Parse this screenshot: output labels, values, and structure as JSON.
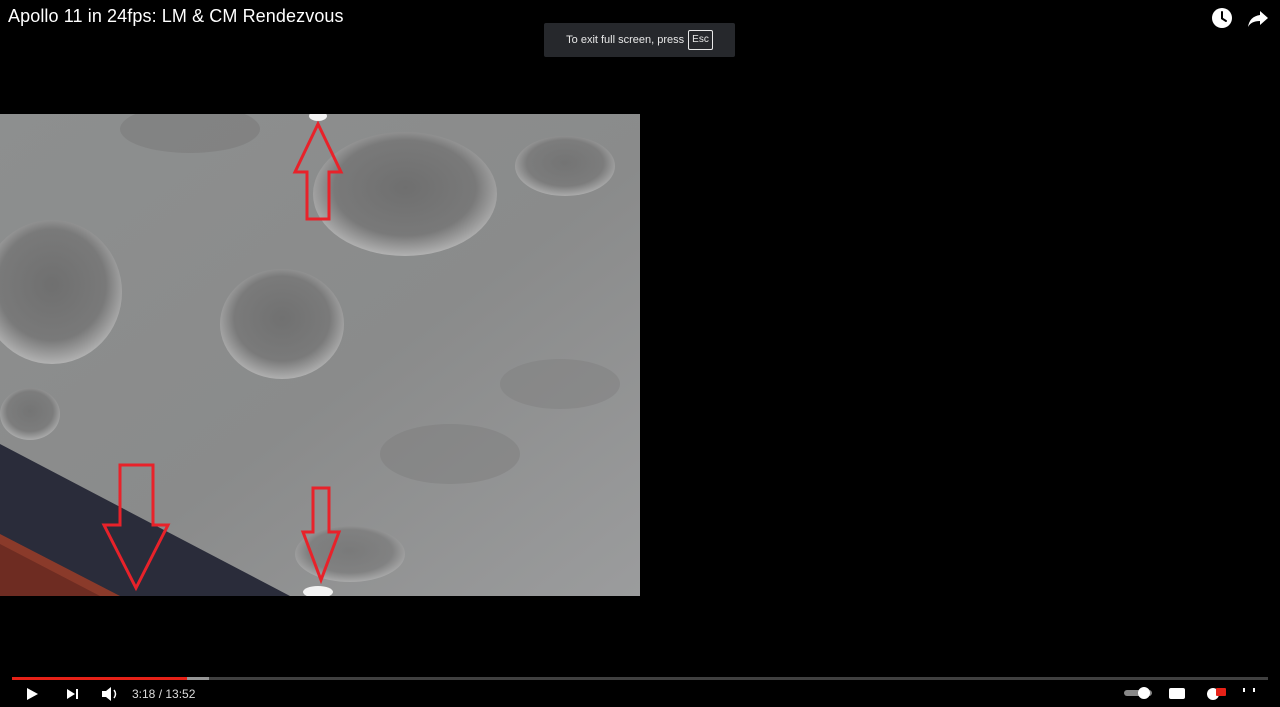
{
  "video": {
    "title": "Apollo 11 in 24fps: LM & CM Rendezvous"
  },
  "toast": {
    "message": "To exit full screen, press",
    "key": "Esc"
  },
  "top_icons": [
    "watch-later-icon",
    "share-icon"
  ],
  "player": {
    "time_display": "3:18 / 13:52",
    "progress_played": 0.139,
    "progress_buffered": 0.157
  },
  "colors": {
    "background": "#000000",
    "progress_played": "#e62117",
    "annotation_arrow": "#e8222a",
    "toast_bg": "#26282c"
  }
}
